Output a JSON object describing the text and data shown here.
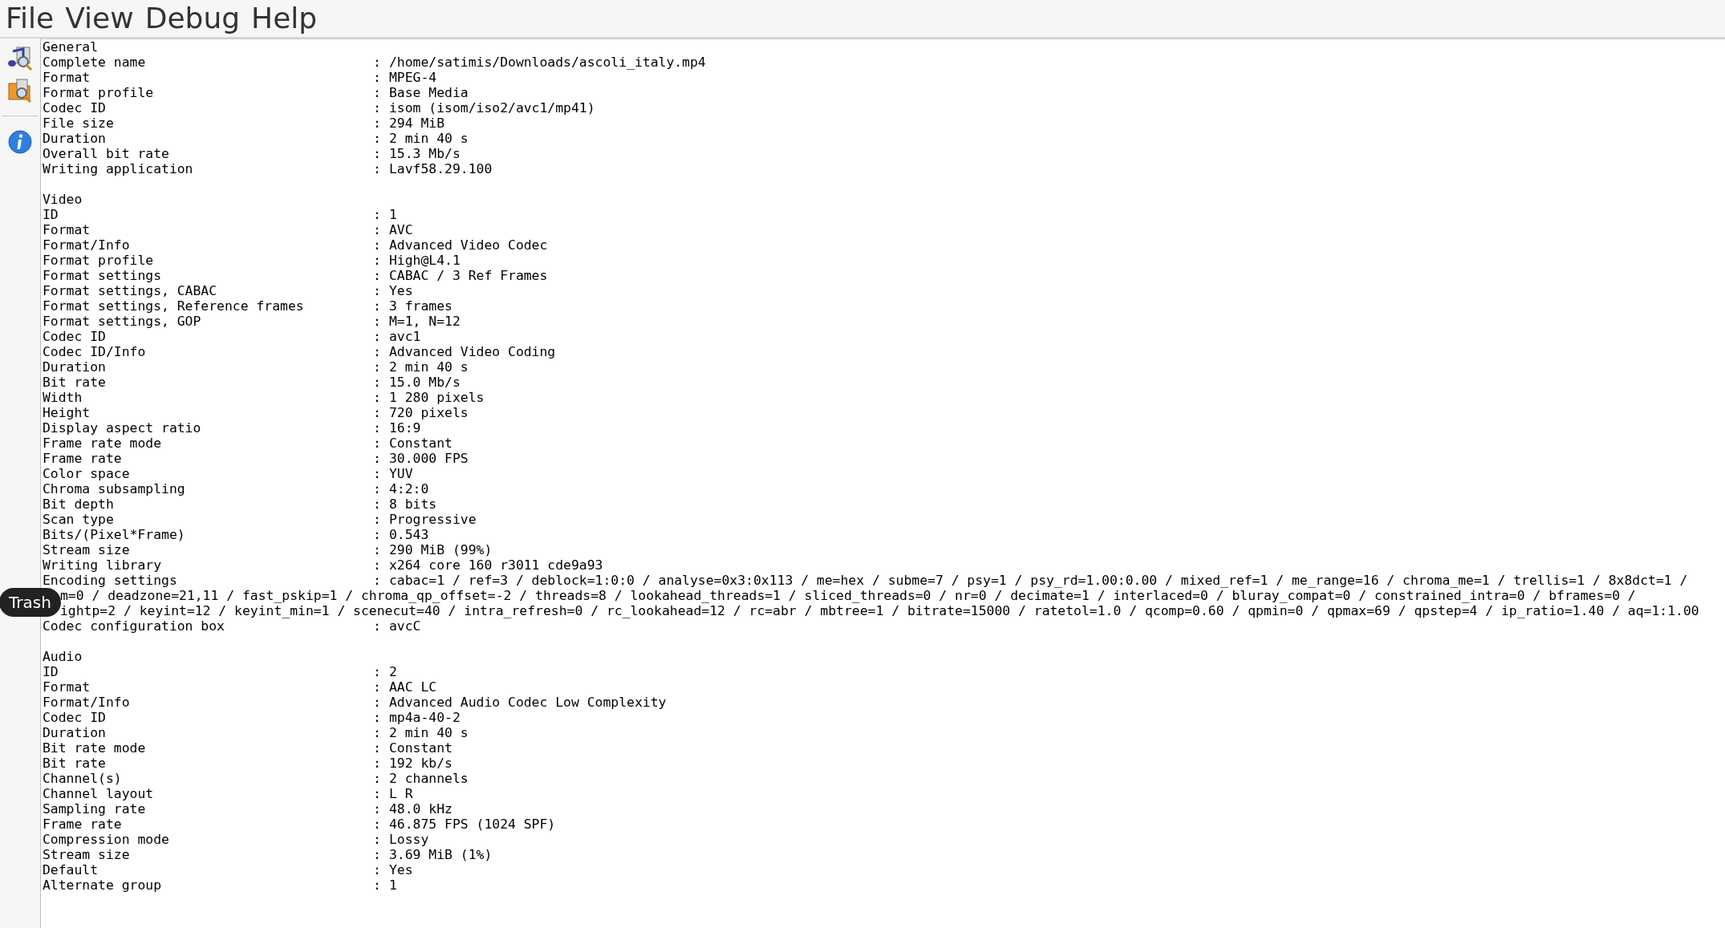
{
  "menu": [
    {
      "label": "File"
    },
    {
      "label": "View"
    },
    {
      "label": "Debug"
    },
    {
      "label": "Help"
    }
  ],
  "toolbar": [
    {
      "kind": "media-search"
    },
    {
      "kind": "folder-search"
    },
    {
      "kind": "separator"
    },
    {
      "kind": "info"
    }
  ],
  "separator": ":",
  "sections": [
    {
      "title": "General",
      "rows": [
        {
          "label": "Complete name",
          "value": "/home/satimis/Downloads/ascoli_italy.mp4"
        },
        {
          "label": "Format",
          "value": "MPEG-4"
        },
        {
          "label": "Format profile",
          "value": "Base Media"
        },
        {
          "label": "Codec ID",
          "value": "isom (isom/iso2/avc1/mp41)"
        },
        {
          "label": "File size",
          "value": "294 MiB"
        },
        {
          "label": "Duration",
          "value": "2 min 40 s"
        },
        {
          "label": "Overall bit rate",
          "value": "15.3 Mb/s"
        },
        {
          "label": "Writing application",
          "value": "Lavf58.29.100"
        }
      ]
    },
    {
      "title": "Video",
      "rows": [
        {
          "label": "ID",
          "value": "1"
        },
        {
          "label": "Format",
          "value": "AVC"
        },
        {
          "label": "Format/Info",
          "value": "Advanced Video Codec"
        },
        {
          "label": "Format profile",
          "value": "High@L4.1"
        },
        {
          "label": "Format settings",
          "value": "CABAC / 3 Ref Frames"
        },
        {
          "label": "Format settings, CABAC",
          "value": "Yes"
        },
        {
          "label": "Format settings, Reference frames",
          "value": "3 frames"
        },
        {
          "label": "Format settings, GOP",
          "value": "M=1, N=12"
        },
        {
          "label": "Codec ID",
          "value": "avc1"
        },
        {
          "label": "Codec ID/Info",
          "value": "Advanced Video Coding"
        },
        {
          "label": "Duration",
          "value": "2 min 40 s"
        },
        {
          "label": "Bit rate",
          "value": "15.0 Mb/s"
        },
        {
          "label": "Width",
          "value": "1 280 pixels"
        },
        {
          "label": "Height",
          "value": "720 pixels"
        },
        {
          "label": "Display aspect ratio",
          "value": "16:9"
        },
        {
          "label": "Frame rate mode",
          "value": "Constant"
        },
        {
          "label": "Frame rate",
          "value": "30.000 FPS"
        },
        {
          "label": "Color space",
          "value": "YUV"
        },
        {
          "label": "Chroma subsampling",
          "value": "4:2:0"
        },
        {
          "label": "Bit depth",
          "value": "8 bits"
        },
        {
          "label": "Scan type",
          "value": "Progressive"
        },
        {
          "label": "Bits/(Pixel*Frame)",
          "value": "0.543"
        },
        {
          "label": "Stream size",
          "value": "290 MiB (99%)"
        },
        {
          "label": "Writing library",
          "value": "x264 core 160 r3011 cde9a93"
        },
        {
          "label": "Encoding settings",
          "value": "cabac=1 / ref=3 / deblock=1:0:0 / analyse=0x3:0x113 / me=hex / subme=7 / psy=1 / psy_rd=1.00:0.00 / mixed_ref=1 / me_range=16 / chroma_me=1 / trellis=1 / 8x8dct=1 /",
          "continuation": [
            "m=0 / deadzone=21,11 / fast_pskip=1 / chroma_qp_offset=-2 / threads=8 / lookahead_threads=1 / sliced_threads=0 / nr=0 / decimate=1 / interlaced=0 / bluray_compat=0 / constrained_intra=0 / bframes=0 /",
            "ightp=2 / keyint=12 / keyint_min=1 / scenecut=40 / intra_refresh=0 / rc_lookahead=12 / rc=abr / mbtree=1 / bitrate=15000 / ratetol=1.0 / qcomp=0.60 / qpmin=0 / qpmax=69 / qpstep=4 / ip_ratio=1.40 / aq=1:1.00"
          ]
        },
        {
          "label": "Codec configuration box",
          "value": "avcC"
        }
      ]
    },
    {
      "title": "Audio",
      "rows": [
        {
          "label": "ID",
          "value": "2"
        },
        {
          "label": "Format",
          "value": "AAC LC"
        },
        {
          "label": "Format/Info",
          "value": "Advanced Audio Codec Low Complexity"
        },
        {
          "label": "Codec ID",
          "value": "mp4a-40-2"
        },
        {
          "label": "Duration",
          "value": "2 min 40 s"
        },
        {
          "label": "Bit rate mode",
          "value": "Constant"
        },
        {
          "label": "Bit rate",
          "value": "192 kb/s"
        },
        {
          "label": "Channel(s)",
          "value": "2 channels"
        },
        {
          "label": "Channel layout",
          "value": "L R"
        },
        {
          "label": "Sampling rate",
          "value": "48.0 kHz"
        },
        {
          "label": "Frame rate",
          "value": "46.875 FPS (1024 SPF)"
        },
        {
          "label": "Compression mode",
          "value": "Lossy"
        },
        {
          "label": "Stream size",
          "value": "3.69 MiB (1%)"
        },
        {
          "label": "Default",
          "value": "Yes"
        },
        {
          "label": "Alternate group",
          "value": "1"
        }
      ]
    }
  ],
  "tooltip": {
    "text": "Trash"
  }
}
